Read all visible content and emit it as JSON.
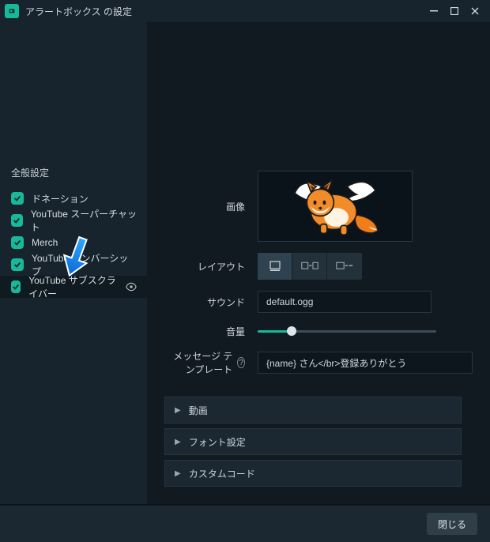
{
  "titlebar": {
    "title": "アラートボックス の設定"
  },
  "sidebar": {
    "heading": "全般設定",
    "items": [
      {
        "label": "ドネーション"
      },
      {
        "label": "YouTube スーパーチャット"
      },
      {
        "label": "Merch"
      },
      {
        "label": "YouTube メンバーシップ"
      },
      {
        "label": "YouTube サブスクライバー"
      }
    ]
  },
  "pane": {
    "image_label": "画像",
    "layout_label": "レイアウト",
    "sound_label": "サウンド",
    "sound_value": "default.ogg",
    "volume_label": "音量",
    "template_label": "メッセージ テンプレート",
    "template_value": "{name} さん</br>登録ありがとう",
    "acc1": "動画",
    "acc2": "フォント設定",
    "acc3": "カスタムコード"
  },
  "footer": {
    "close": "閉じる"
  }
}
